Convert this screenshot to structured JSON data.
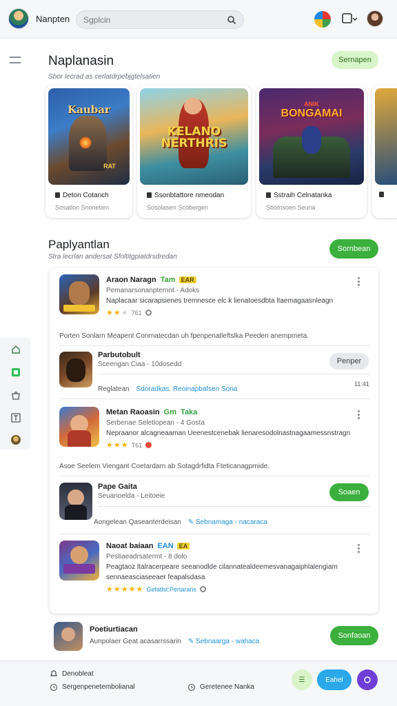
{
  "topbar": {
    "title": "Nanpten",
    "search_placeholder": "Sgplcin",
    "icons": [
      "avatar",
      "search-icon",
      "game-icon",
      "chat-icon",
      "profile-avatar"
    ]
  },
  "featured": {
    "title": "Naplanasin",
    "subtitle": "Sbor lecrad as cerlatdrpebjgtelsatien",
    "button": "Sernapen",
    "cards": [
      {
        "art_title": "Kaubar",
        "art_sub": "RAT",
        "name": "Deton Cotanch",
        "meta": "Sosatlon Snonetien"
      },
      {
        "art_title": "KELANO NERTHRIS",
        "art_sub": "",
        "name": "Ssonbtattore nmeodan",
        "meta": "Sosolaserr Scobergen"
      },
      {
        "art_title": "BONGAMAI",
        "art_sub": "ANIK",
        "name": "Sstraih Celnatanka",
        "meta": "Sbomsoen Seuna"
      }
    ]
  },
  "list": {
    "title": "Paplyantlan",
    "subtitle": "Stra lecrlan andersat Sfoltitgpiatdrsdredan",
    "button": "Sornbean",
    "rows": [
      {
        "title": "Araon Naragn",
        "tag1": "Tam",
        "tag2": "EAR",
        "sub": "Pemanarsonanpternnt - Adoks",
        "desc": "Naplacaar sicarapsienes tremnesce elc k lienatoesdbta ltaemagaasnleagn",
        "rating": "761",
        "note": "Porten Sonlarn Meapent Conrnatecdan uh fpenpenatleftslka Peeden anempmeta."
      },
      {
        "title": "Parbutobult",
        "sub": "Sceengan Ciaa - 10dosedd",
        "button": "Penper",
        "note": "Reglatean",
        "link": "Sdoradkas.  Reoinapbafsen Sona",
        "time": "11:41"
      },
      {
        "title": "Metan Raoasin",
        "tag1": "Gm",
        "tag2": "Taka",
        "sub": "Serbenae Seletlopean - 4 Gosta",
        "desc": "Nepraanor alcagneaaman Ueenestcenebak lienaresodolnastnagaamessnstragn",
        "rating": "T61",
        "note": "Asoe Seelem Viengant Coetardarn ab Sotagdrfidta Fteticanagprnide."
      },
      {
        "title": "Pape Gaita",
        "sub": "Seuanoelda - Leitoeie",
        "button": "Soaen",
        "note": "Aongelean Qaseanterdeisan",
        "link": "Sebnamaga - nacaraca"
      },
      {
        "title": "Naoat baiaan",
        "tag1": "EAN",
        "tag2": "EA",
        "sub": "Pestiaeadrsatermt - 8 dolo",
        "desc": "Peagtaoz ltalracerpeare seeanodlde cilannatealdeemesvanagaiphlalengiam",
        "desc2": "sennaeasciaseeaer feapalsdasa",
        "link": "Gefatlst:Pertarans"
      }
    ]
  },
  "extra_row": {
    "title": "Poetiurtiacan",
    "sub": "Aunpolaer Geat acasarrssarin",
    "link": "Sebnaarga - wahaca",
    "button": "Sonfaoan"
  },
  "bottombar": {
    "item1": "Denobleat",
    "item2": "Sergenpenetembolianal",
    "item3": "Geretenee Nanka",
    "action_label": "Eahel"
  },
  "colors": {
    "accent_green": "#3bb03d",
    "light_green": "#d7f5c8",
    "star_yellow": "#f2b400",
    "link_blue": "#2392d6",
    "action_blue": "#2aa8ea",
    "action_purple": "#6f3ed6"
  }
}
